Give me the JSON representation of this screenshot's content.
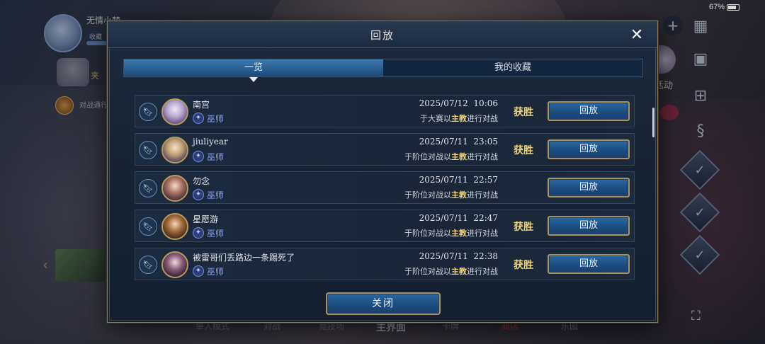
{
  "status_bar": {
    "battery": "67%"
  },
  "background": {
    "player_name": "无情小梦",
    "player_tag": "收藏",
    "side_text1": "夹",
    "side_text2": "对战通行证",
    "right_label": "活动",
    "bottom_nav": [
      "单人模式",
      "对战",
      "竞技场",
      "主界面",
      "卡牌",
      "商店",
      "乐园"
    ]
  },
  "modal": {
    "title": "回放",
    "tabs": [
      {
        "label": "一览",
        "active": true
      },
      {
        "label": "我的收藏",
        "active": false
      }
    ],
    "replays": [
      {
        "player": "南宫",
        "class": "巫师",
        "time": "2025/07/12  10:06",
        "desc_pre": "于大赛以",
        "desc_bold": "主教",
        "desc_post": "进行对战",
        "result": "获胜",
        "button": "回放"
      },
      {
        "player": "jiuliyear",
        "class": "巫师",
        "time": "2025/07/11  23:05",
        "desc_pre": "于阶位对战以",
        "desc_bold": "主教",
        "desc_post": "进行对战",
        "result": "获胜",
        "button": "回放"
      },
      {
        "player": "勿念",
        "class": "巫师",
        "time": "2025/07/11  22:57",
        "desc_pre": "于阶位对战以",
        "desc_bold": "主教",
        "desc_post": "进行对战",
        "result": "",
        "button": "回放"
      },
      {
        "player": "星愿游",
        "class": "巫师",
        "time": "2025/07/11  22:47",
        "desc_pre": "于阶位对战以",
        "desc_bold": "主教",
        "desc_post": "进行对战",
        "result": "获胜",
        "button": "回放"
      },
      {
        "player": "被雷哥们丢路边一条踢死了",
        "class": "巫师",
        "time": "2025/07/11  22:38",
        "desc_pre": "于阶位对战以",
        "desc_bold": "主教",
        "desc_post": "进行对战",
        "result": "获胜",
        "button": "回放"
      }
    ],
    "close_label": "关闭"
  },
  "icons": {
    "close": "close-icon",
    "bookmark": "bookmark-icon",
    "class": "wizard-class-icon"
  },
  "colors": {
    "accent_gold": "#a89460",
    "win_text": "#f0d47a",
    "class_text": "#8ea4ff",
    "button_blue": "#1c4c80"
  }
}
